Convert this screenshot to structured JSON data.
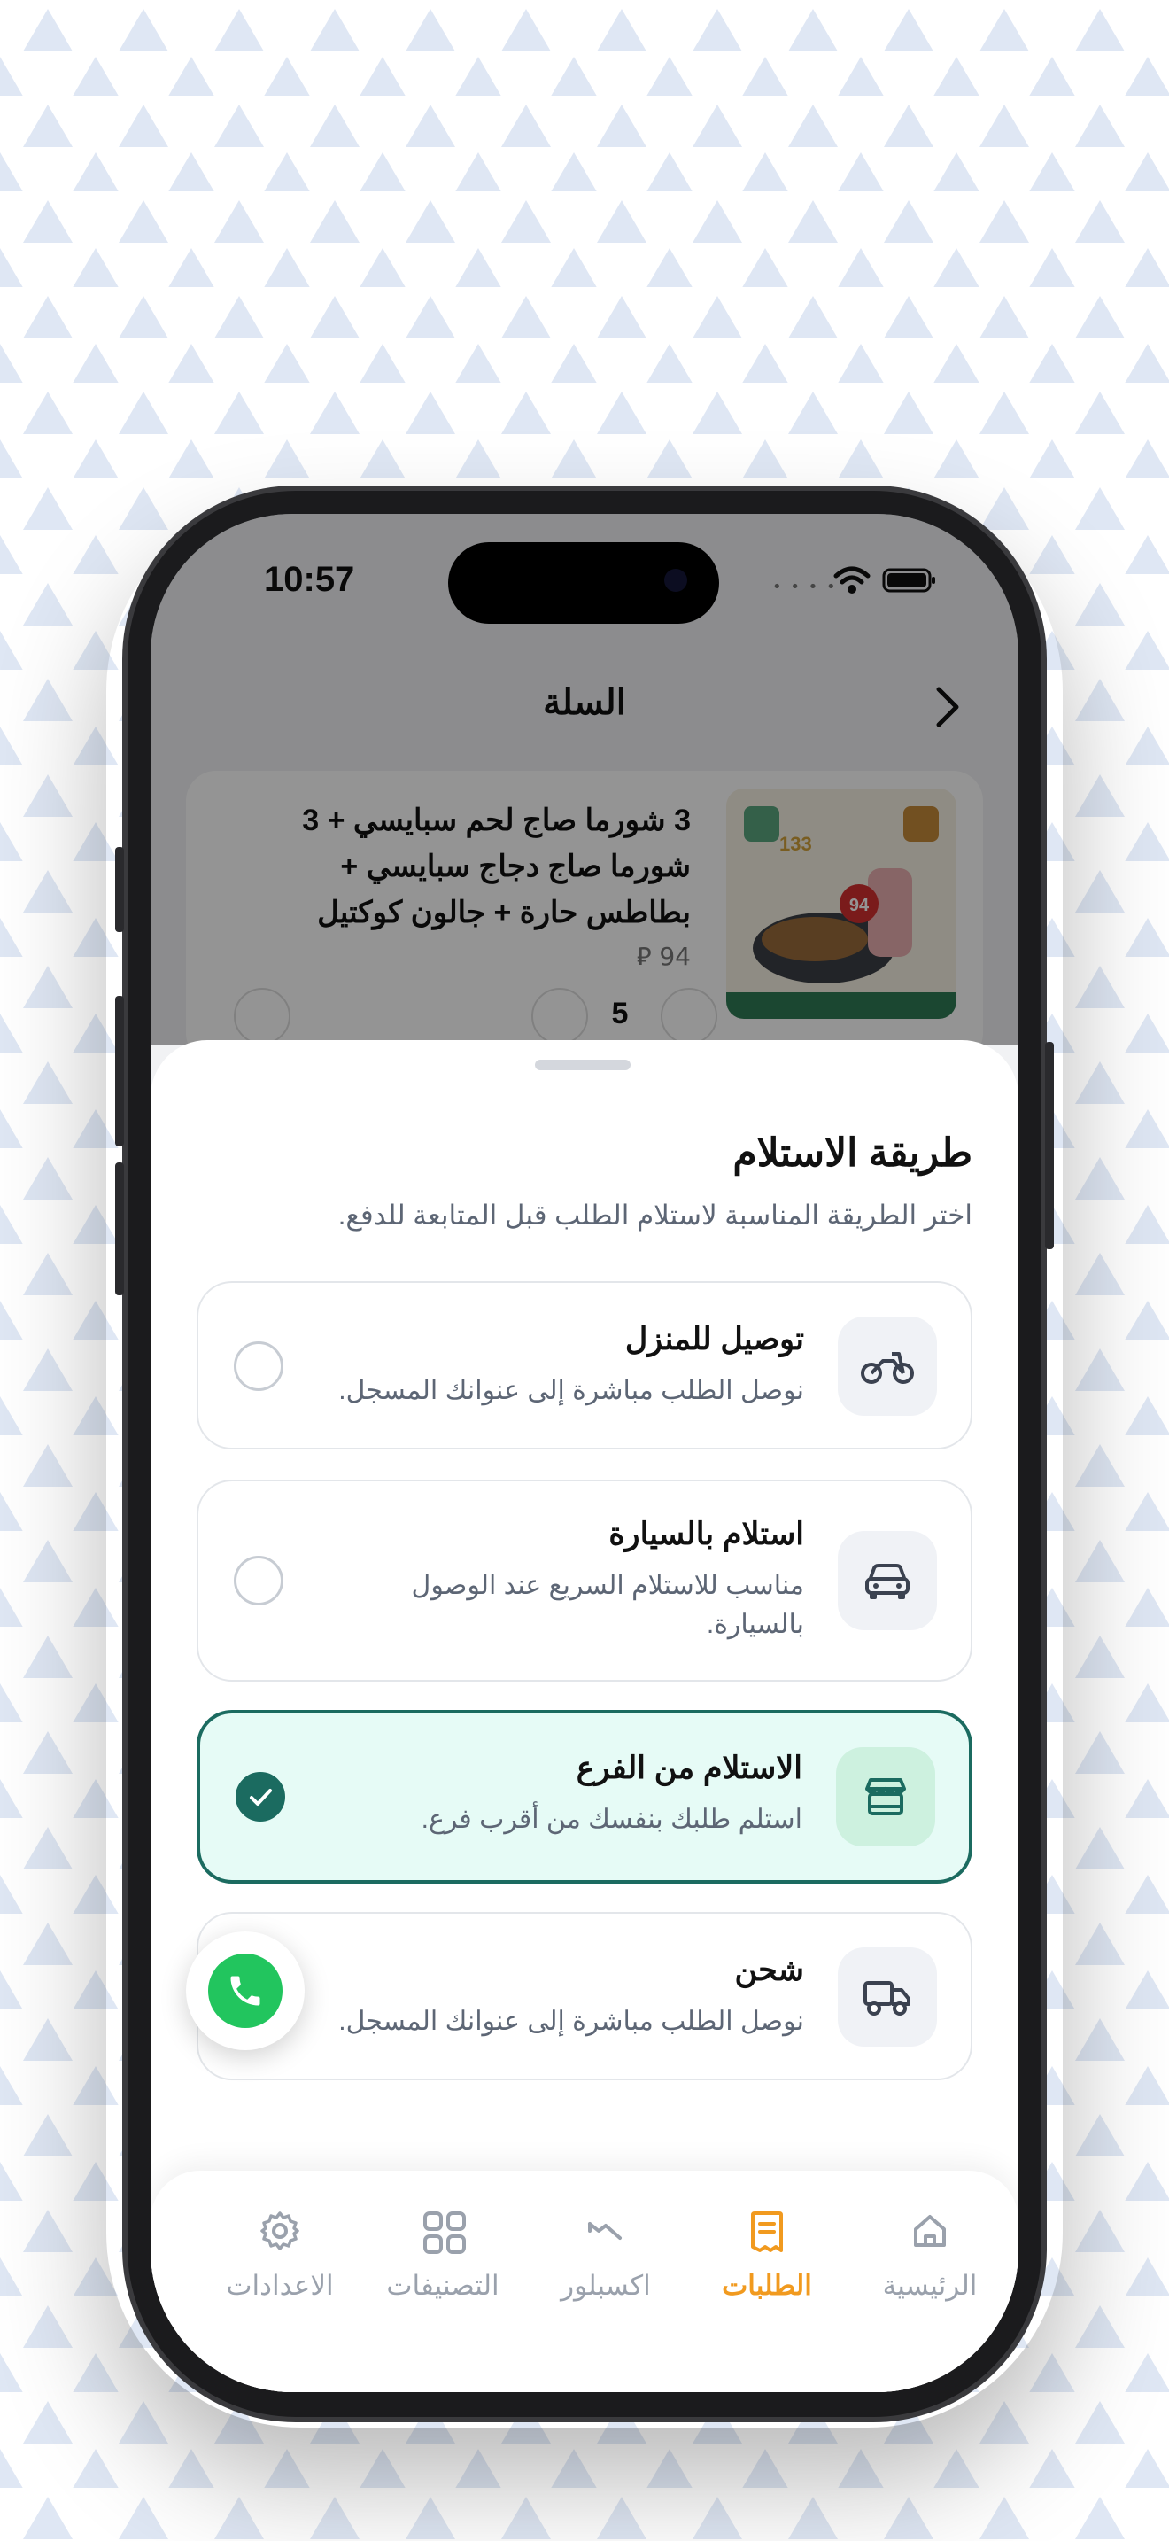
{
  "status_bar": {
    "time": "10:57"
  },
  "header": {
    "title": "السلة"
  },
  "cart_item": {
    "title": "3 شورما صاج لحم سبايسي + 3 شورما صاج دجاج سبايسي + بطاطس حارة + جالون كوكتيل",
    "price": "94 ⃁",
    "quantity": "5"
  },
  "sheet": {
    "title": "طريقة الاستلام",
    "subtitle": "اختر الطريقة المناسبة لاستلام الطلب قبل المتابعة للدفع.",
    "options": [
      {
        "title": "توصيل للمنزل",
        "desc": "نوصل الطلب مباشرة إلى عنوانك المسجل.",
        "icon": "motorcycle-icon",
        "selected": false
      },
      {
        "title": "استلام بالسيارة",
        "desc": "مناسب للاستلام السريع عند الوصول بالسيارة.",
        "icon": "car-icon",
        "selected": false
      },
      {
        "title": "الاستلام من الفرع",
        "desc": "استلم طلبك بنفسك من أقرب فرع.",
        "icon": "store-icon",
        "selected": true
      },
      {
        "title": "شحن",
        "desc": "نوصل الطلب مباشرة إلى عنوانك المسجل.",
        "icon": "truck-icon",
        "selected": false
      }
    ]
  },
  "tabs": [
    {
      "label": "الرئيسية",
      "icon": "home-icon"
    },
    {
      "label": "الطلبات",
      "icon": "orders-icon",
      "active": true
    },
    {
      "label": "اكسبلور",
      "icon": "explore-icon"
    },
    {
      "label": "التصنيفات",
      "icon": "categories-icon"
    },
    {
      "label": "الاعدادات",
      "icon": "settings-icon"
    }
  ],
  "colors": {
    "accent": "#1b6b60",
    "selected_bg": "#e6fbf6",
    "tab_active": "#f19a1f",
    "call_green": "#22c55e"
  }
}
